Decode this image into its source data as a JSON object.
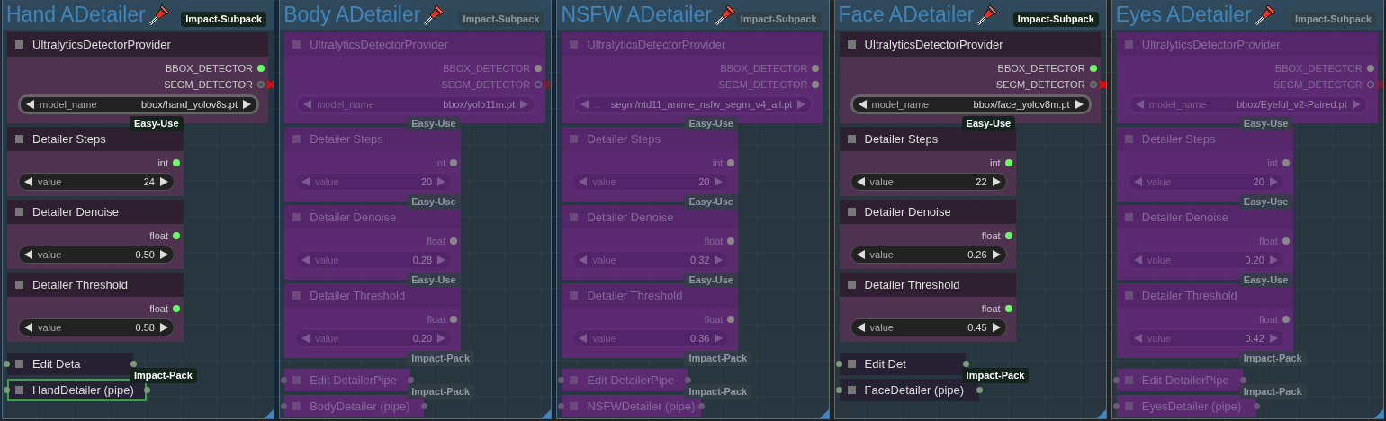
{
  "groups": [
    {
      "title": "Hand ADetailer",
      "bypassed": false,
      "badge": "Impact-Subpack",
      "nodes": [
        {
          "kind": "provider",
          "title": "UltralyticsDetectorProvider",
          "selected": false,
          "outputs": [
            {
              "label": "BBOX_DETECTOR",
              "connected": true,
              "error": false
            },
            {
              "label": "SEGM_DETECTOR",
              "connected": false,
              "error": true
            }
          ],
          "widget": {
            "label": "model_name",
            "value": "bbox/hand_yolov8s.pt"
          },
          "badge": "Easy-Use"
        },
        {
          "kind": "primitive",
          "title": "Detailer Steps",
          "selected": false,
          "outputs": [
            {
              "label": "int",
              "connected": true,
              "error": false
            }
          ],
          "widget": {
            "label": "value",
            "value": "24"
          }
        },
        {
          "kind": "primitive",
          "title": "Detailer Denoise",
          "selected": false,
          "outputs": [
            {
              "label": "float",
              "connected": true,
              "error": false
            }
          ],
          "widget": {
            "label": "value",
            "value": "0.50"
          }
        },
        {
          "kind": "primitive",
          "title": "Detailer Threshold",
          "selected": false,
          "outputs": [
            {
              "label": "float",
              "connected": true,
              "error": false
            }
          ],
          "widget": {
            "label": "value",
            "value": "0.58"
          }
        },
        {
          "kind": "pipe",
          "title": "Edit Deta",
          "selected": false,
          "badge": "Impact-Pack"
        },
        {
          "kind": "pipe",
          "title": "HandDetailer (pipe)",
          "selected": true
        }
      ]
    },
    {
      "title": "Body ADetailer",
      "bypassed": true,
      "badge": "Impact-Subpack",
      "nodes": [
        {
          "kind": "provider",
          "title": "UltralyticsDetectorProvider",
          "selected": false,
          "outputs": [
            {
              "label": "BBOX_DETECTOR",
              "connected": true,
              "error": false
            },
            {
              "label": "SEGM_DETECTOR",
              "connected": false,
              "error": true
            }
          ],
          "widget": {
            "label": "model_name",
            "value": "bbox/yolo11m.pt"
          },
          "badge": "Easy-Use"
        },
        {
          "kind": "primitive",
          "title": "Detailer Steps",
          "selected": false,
          "outputs": [
            {
              "label": "int",
              "connected": true,
              "error": false
            }
          ],
          "widget": {
            "label": "value",
            "value": "20"
          },
          "badge": "Easy-Use"
        },
        {
          "kind": "primitive",
          "title": "Detailer Denoise",
          "selected": false,
          "outputs": [
            {
              "label": "float",
              "connected": true,
              "error": false
            }
          ],
          "widget": {
            "label": "value",
            "value": "0.28"
          },
          "badge": "Easy-Use"
        },
        {
          "kind": "primitive",
          "title": "Detailer Threshold",
          "selected": false,
          "outputs": [
            {
              "label": "float",
              "connected": true,
              "error": false
            }
          ],
          "widget": {
            "label": "value",
            "value": "0.20"
          },
          "badge": "Impact-Pack"
        },
        {
          "kind": "pipe",
          "title": "Edit DetailerPipe",
          "selected": false,
          "badge": "Impact-Pack"
        },
        {
          "kind": "pipe",
          "title": "BodyDetailer (pipe)",
          "selected": false
        }
      ]
    },
    {
      "title": "NSFW ADetailer",
      "bypassed": true,
      "badge": "Impact-Subpack",
      "nodes": [
        {
          "kind": "provider",
          "title": "UltralyticsDetectorProvider",
          "selected": false,
          "outputs": [
            {
              "label": "BBOX_DETECTOR",
              "connected": true,
              "error": false
            },
            {
              "label": "SEGM_DETECTOR",
              "connected": true,
              "error": false
            }
          ],
          "widget": {
            "label": "..",
            "value": "segm/ntd11_anime_nsfw_segm_v4_all.pt"
          },
          "badge": "Easy-Use"
        },
        {
          "kind": "primitive",
          "title": "Detailer Steps",
          "selected": false,
          "outputs": [
            {
              "label": "int",
              "connected": true,
              "error": false
            }
          ],
          "widget": {
            "label": "value",
            "value": "20"
          },
          "badge": "Easy-Use"
        },
        {
          "kind": "primitive",
          "title": "Detailer Denoise",
          "selected": false,
          "outputs": [
            {
              "label": "float",
              "connected": true,
              "error": false
            }
          ],
          "widget": {
            "label": "value",
            "value": "0.32"
          },
          "badge": "Easy-Use"
        },
        {
          "kind": "primitive",
          "title": "Detailer Threshold",
          "selected": false,
          "outputs": [
            {
              "label": "float",
              "connected": true,
              "error": false
            }
          ],
          "widget": {
            "label": "value",
            "value": "0.36"
          },
          "badge": "Impact-Pack"
        },
        {
          "kind": "pipe",
          "title": "Edit DetailerPipe",
          "selected": false,
          "badge": "Impact-Pack"
        },
        {
          "kind": "pipe",
          "title": "NSFWDetailer (pipe)",
          "selected": false
        }
      ]
    },
    {
      "title": "Face ADetailer",
      "bypassed": false,
      "badge": "Impact-Subpack",
      "nodes": [
        {
          "kind": "provider",
          "title": "UltralyticsDetectorProvider",
          "selected": false,
          "outputs": [
            {
              "label": "BBOX_DETECTOR",
              "connected": true,
              "error": false
            },
            {
              "label": "SEGM_DETECTOR",
              "connected": false,
              "error": true
            }
          ],
          "widget": {
            "label": "model_name",
            "value": "bbox/face_yolov8m.pt"
          },
          "badge": "Easy-Use"
        },
        {
          "kind": "primitive",
          "title": "Detailer Steps",
          "selected": false,
          "outputs": [
            {
              "label": "int",
              "connected": true,
              "error": false
            }
          ],
          "widget": {
            "label": "value",
            "value": "22"
          }
        },
        {
          "kind": "primitive",
          "title": "Detailer Denoise",
          "selected": false,
          "outputs": [
            {
              "label": "float",
              "connected": true,
              "error": false
            }
          ],
          "widget": {
            "label": "value",
            "value": "0.26"
          }
        },
        {
          "kind": "primitive",
          "title": "Detailer Threshold",
          "selected": false,
          "outputs": [
            {
              "label": "float",
              "connected": true,
              "error": false
            }
          ],
          "widget": {
            "label": "value",
            "value": "0.45"
          }
        },
        {
          "kind": "pipe",
          "title": "Edit Det",
          "selected": false,
          "badge": "Impact-Pack"
        },
        {
          "kind": "pipe",
          "title": "FaceDetailer (pipe)",
          "selected": false
        }
      ]
    },
    {
      "title": "Eyes ADetailer",
      "bypassed": true,
      "badge": "Impact-Subpack",
      "nodes": [
        {
          "kind": "provider",
          "title": "UltralyticsDetectorProvider",
          "selected": false,
          "outputs": [
            {
              "label": "BBOX_DETECTOR",
              "connected": true,
              "error": false
            },
            {
              "label": "SEGM_DETECTOR",
              "connected": false,
              "error": true
            }
          ],
          "widget": {
            "label": "model_name",
            "value": "bbox/Eyeful_v2-Paired.pt"
          },
          "badge": "Easy-Use"
        },
        {
          "kind": "primitive",
          "title": "Detailer Steps",
          "selected": false,
          "outputs": [
            {
              "label": "int",
              "connected": true,
              "error": false
            }
          ],
          "widget": {
            "label": "value",
            "value": "20"
          },
          "badge": "Easy-Use"
        },
        {
          "kind": "primitive",
          "title": "Detailer Denoise",
          "selected": false,
          "outputs": [
            {
              "label": "float",
              "connected": true,
              "error": false
            }
          ],
          "widget": {
            "label": "value",
            "value": "0.20"
          },
          "badge": "Easy-Use"
        },
        {
          "kind": "primitive",
          "title": "Detailer Threshold",
          "selected": false,
          "outputs": [
            {
              "label": "float",
              "connected": true,
              "error": false
            }
          ],
          "widget": {
            "label": "value",
            "value": "0.42"
          },
          "badge": "Impact-Pack"
        },
        {
          "kind": "pipe",
          "title": "Edit DetailerPipe",
          "selected": false,
          "badge": "Impact-Pack"
        },
        {
          "kind": "pipe",
          "title": "EyesDetailer (pipe)",
          "selected": false
        }
      ]
    }
  ]
}
